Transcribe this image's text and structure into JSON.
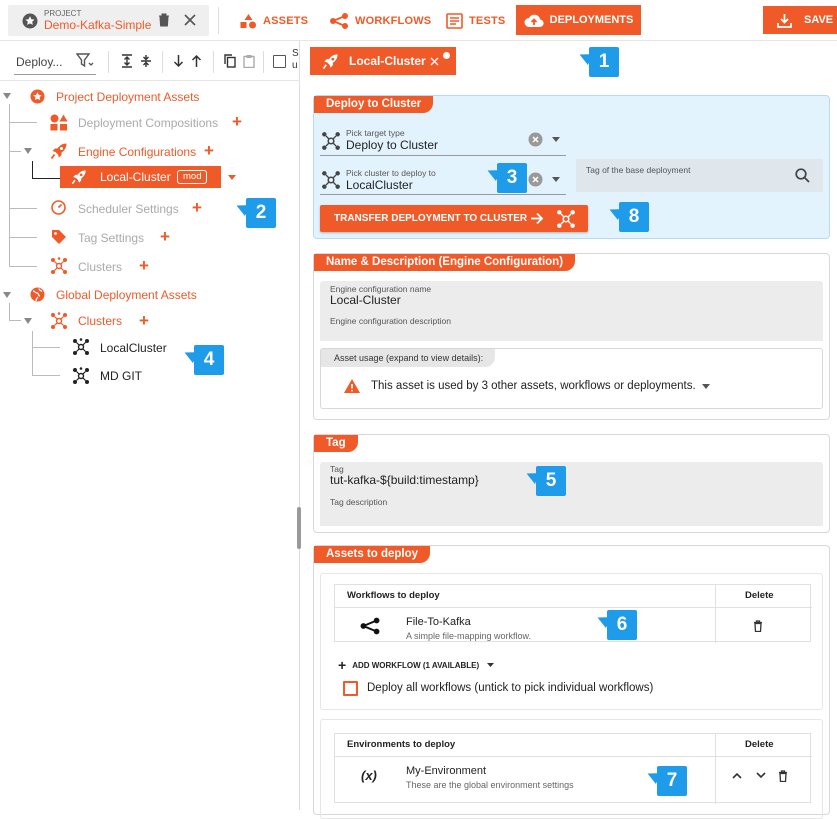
{
  "topbar": {
    "project_caption": "PROJECT",
    "project_name": "Demo-Kafka-Simple",
    "nav": [
      {
        "label": "ASSETS",
        "icon": "assets-icon"
      },
      {
        "label": "WORKFLOWS",
        "icon": "workflow-icon"
      },
      {
        "label": "TESTS",
        "icon": "tests-icon"
      },
      {
        "label": "DEPLOYMENTS",
        "icon": "cloud-upload-icon",
        "active": true
      }
    ],
    "save_label": "SAVE"
  },
  "sidebar": {
    "filter_value": "Deploy...",
    "cut_text": "S\nu",
    "project_section": "Project Deployment Assets",
    "items": [
      {
        "label": "Deployment Compositions"
      },
      {
        "label": "Engine Configurations"
      },
      {
        "label": "Local-Cluster",
        "badge": "mod"
      },
      {
        "label": "Scheduler Settings"
      },
      {
        "label": "Tag Settings"
      },
      {
        "label": "Clusters"
      }
    ],
    "global_section": "Global Deployment Assets",
    "global_items": [
      {
        "label": "Clusters"
      },
      {
        "label": "LocalCluster"
      },
      {
        "label": "MD GIT"
      }
    ]
  },
  "editor_tab": {
    "label": "Local-Cluster"
  },
  "deploy_panel": {
    "title": "Deploy to Cluster",
    "target_type_label": "Pick target type",
    "target_type_value": "Deploy to Cluster",
    "cluster_label": "Pick cluster to deploy to",
    "cluster_value": "LocalCluster",
    "base_tag_label": "Tag of the base deployment",
    "transfer_button": "TRANSFER DEPLOYMENT TO CLUSTER"
  },
  "name_panel": {
    "title": "Name & Description (Engine Configuration)",
    "name_label": "Engine configuration name",
    "name_value": "Local-Cluster",
    "desc_label": "Engine configuration description",
    "usage_label": "Asset usage (expand to view details):",
    "usage_text": "This asset is used by 3 other assets, workflows or deployments."
  },
  "tag_panel": {
    "title": "Tag",
    "tag_label": "Tag",
    "tag_value": "tut-kafka-${build:timestamp}",
    "desc_label": "Tag description"
  },
  "assets_panel": {
    "title": "Assets to deploy",
    "workflows_header": "Workflows to deploy",
    "delete_header": "Delete",
    "workflow_name": "File-To-Kafka",
    "workflow_desc": "A simple file-mapping workflow.",
    "add_workflow": "ADD WORKFLOW (1 AVAILABLE)",
    "deploy_all": "Deploy all workflows (untick to pick individual workflows)",
    "env_header": "Environments to deploy",
    "env_delete_header": "Delete",
    "env_symbol": "(x)",
    "env_name": "My-Environment",
    "env_desc": "These are the global environment settings"
  },
  "callouts": [
    "1",
    "2",
    "3",
    "4",
    "5",
    "6",
    "7",
    "8"
  ],
  "colors": {
    "accent": "#f05a28",
    "callout": "#1e9be9",
    "deploy_bg": "#e3f3fd"
  }
}
